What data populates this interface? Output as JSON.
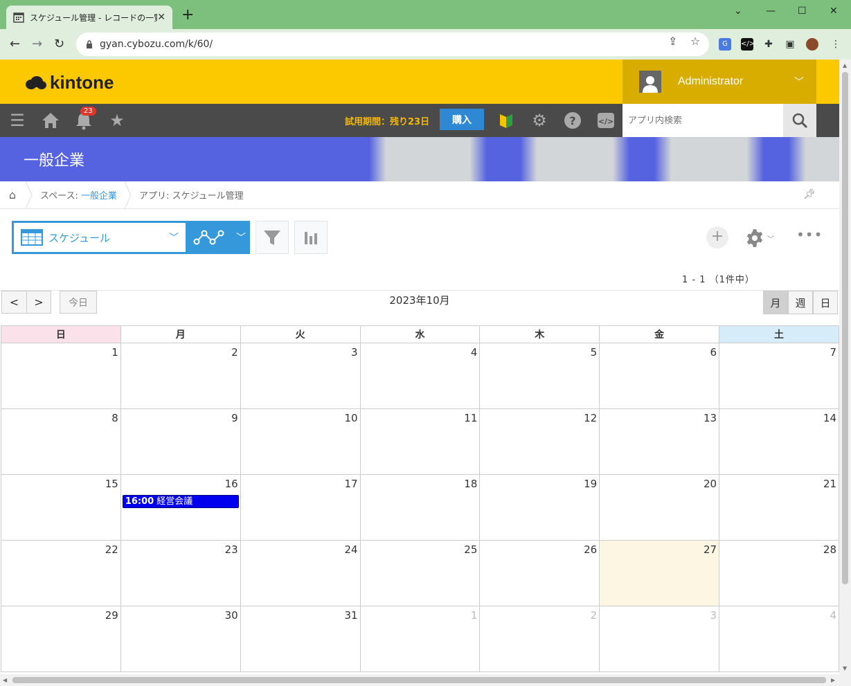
{
  "browser": {
    "tab_title": "スケジュール管理 - レコードの一覧",
    "tab_close": "✕",
    "new_tab": "+",
    "url": "gyan.cybozu.com/k/60/",
    "window_min": "—",
    "window_max": "☐",
    "window_close": "✕",
    "tab_list": "⌄"
  },
  "kintone": {
    "logo_text": "kintone",
    "user_name": "Administrator",
    "notification_count": "23",
    "trial_text": "試用期間：残り23日",
    "buy_label": "購入",
    "search_placeholder": "アプリ内検索",
    "space_title": "一般企業",
    "breadcrumb": {
      "space_prefix": "スペース: ",
      "space_link": "一般企業",
      "app_label": "アプリ: スケジュール管理"
    },
    "view_label": "スケジュール",
    "record_count": "1 - 1 （1件中）"
  },
  "calendar": {
    "title": "2023年10月",
    "prev": "<",
    "next": ">",
    "today_label": "今日",
    "modes": [
      "月",
      "週",
      "日"
    ],
    "active_mode": "月",
    "weekdays": [
      "日",
      "月",
      "火",
      "水",
      "木",
      "金",
      "土"
    ],
    "weeks": [
      [
        {
          "d": "1"
        },
        {
          "d": "2"
        },
        {
          "d": "3"
        },
        {
          "d": "4"
        },
        {
          "d": "5"
        },
        {
          "d": "6"
        },
        {
          "d": "7"
        }
      ],
      [
        {
          "d": "8"
        },
        {
          "d": "9"
        },
        {
          "d": "10"
        },
        {
          "d": "11"
        },
        {
          "d": "12"
        },
        {
          "d": "13"
        },
        {
          "d": "14"
        }
      ],
      [
        {
          "d": "15"
        },
        {
          "d": "16",
          "event": {
            "time": "16:00",
            "title": "経営会議"
          }
        },
        {
          "d": "17"
        },
        {
          "d": "18"
        },
        {
          "d": "19"
        },
        {
          "d": "20"
        },
        {
          "d": "21"
        }
      ],
      [
        {
          "d": "22"
        },
        {
          "d": "23"
        },
        {
          "d": "24"
        },
        {
          "d": "25"
        },
        {
          "d": "26"
        },
        {
          "d": "27",
          "today": true
        },
        {
          "d": "28"
        }
      ],
      [
        {
          "d": "29"
        },
        {
          "d": "30"
        },
        {
          "d": "31"
        },
        {
          "d": "1",
          "other": true
        },
        {
          "d": "2",
          "other": true
        },
        {
          "d": "3",
          "other": true
        },
        {
          "d": "4",
          "other": true
        }
      ]
    ]
  },
  "colors": {
    "kintone_yellow": "#fcc800",
    "accent_blue": "#3498db",
    "event_blue": "#0000ee",
    "today_bg": "#fdf6e3"
  }
}
